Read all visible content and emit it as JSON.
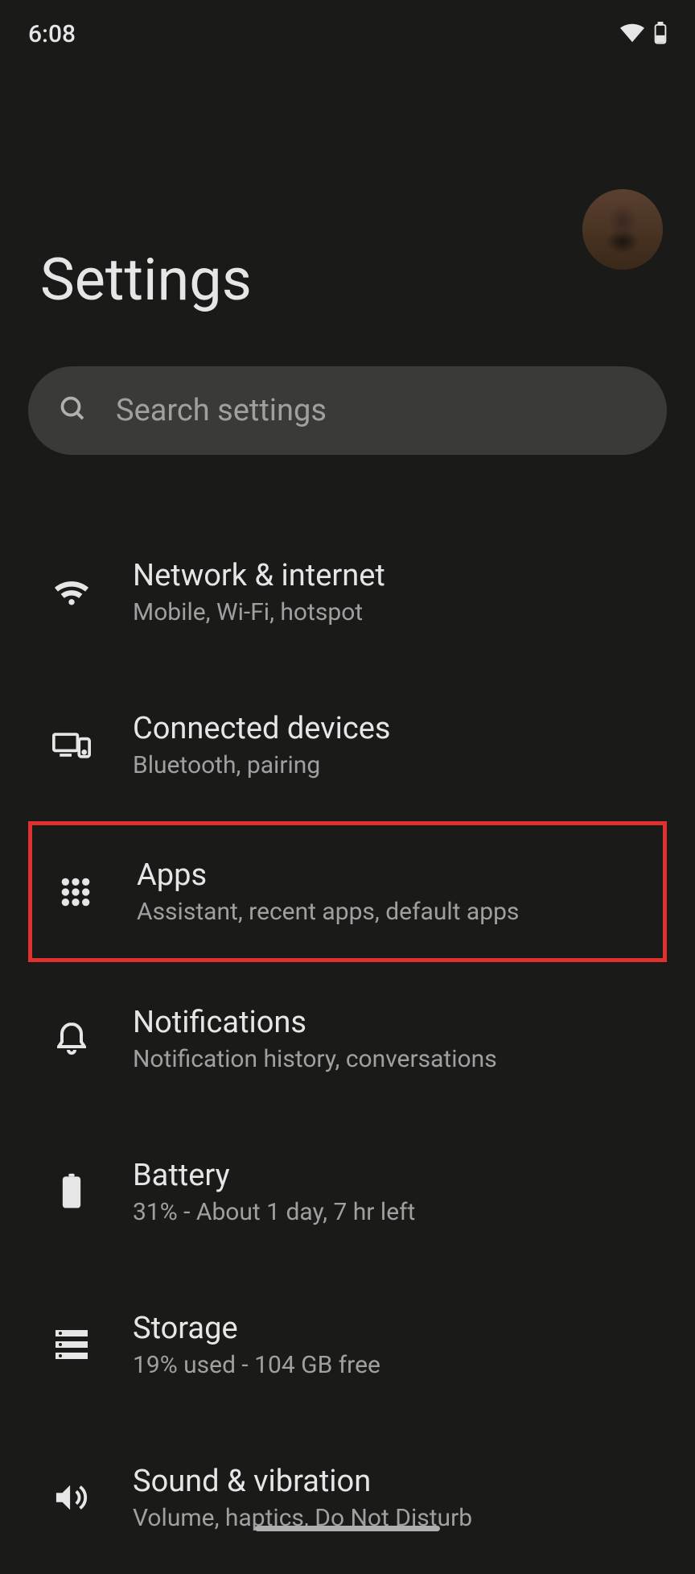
{
  "statusBar": {
    "time": "6:08"
  },
  "header": {
    "title": "Settings"
  },
  "search": {
    "placeholder": "Search settings"
  },
  "settings": [
    {
      "title": "Network & internet",
      "subtitle": "Mobile, Wi-Fi, hotspot",
      "icon": "wifi"
    },
    {
      "title": "Connected devices",
      "subtitle": "Bluetooth, pairing",
      "icon": "devices"
    },
    {
      "title": "Apps",
      "subtitle": "Assistant, recent apps, default apps",
      "icon": "apps",
      "highlighted": true
    },
    {
      "title": "Notifications",
      "subtitle": "Notification history, conversations",
      "icon": "bell"
    },
    {
      "title": "Battery",
      "subtitle": "31% - About 1 day, 7 hr left",
      "icon": "battery"
    },
    {
      "title": "Storage",
      "subtitle": "19% used - 104 GB free",
      "icon": "storage"
    },
    {
      "title": "Sound & vibration",
      "subtitle": "Volume, haptics, Do Not Disturb",
      "icon": "sound"
    }
  ]
}
